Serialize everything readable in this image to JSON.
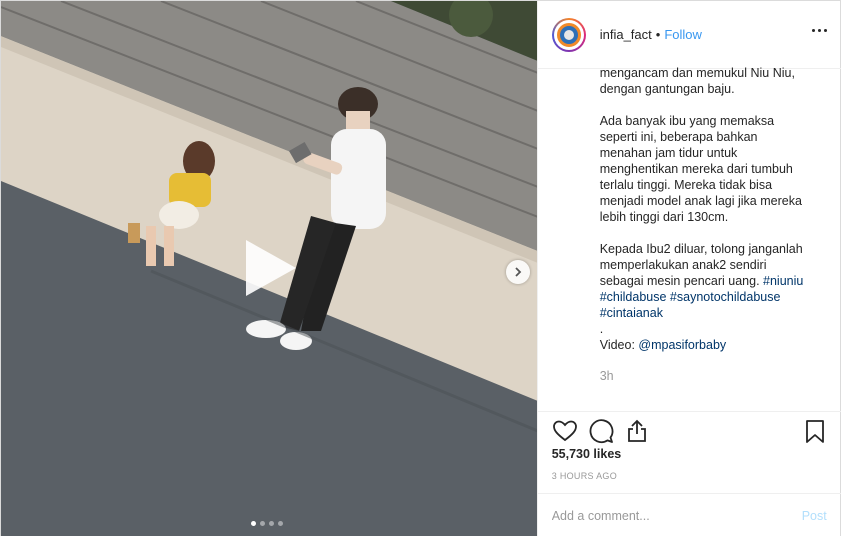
{
  "header": {
    "username": "infia_fact",
    "separator": "•",
    "follow_label": "Follow"
  },
  "caption": {
    "lines_part1": "mengancam dan memukul Niu Niu,\ndengan gantungan baju.",
    "lines_part2": "Ada banyak ibu yang memaksa\nseperti ini, beberapa bahkan\nmenahan jam tidur untuk\nmenghentikan mereka dari tumbuh\nterlalu tinggi. Mereka tidak bisa\nmenjadi model anak lagi jika mereka\nlebih tinggi dari 130cm.",
    "lines_part3_a": "Kepada Ibu2 diluar, tolong janganlah\nmemperlakukan anak2 sendiri\nsebagai mesin pencari uang. ",
    "hashtag_1": "#niuniu",
    "hashtag_2": "#childabuse",
    "hashtag_3": "#saynotochildabuse",
    "hashtag_4": "#cintaianak",
    "dot_line": ".",
    "video_label": "Video: ",
    "video_mention": "@mpasiforbaby"
  },
  "time_short": "3h",
  "likes": "55,730 likes",
  "time_ago": "3 HOURS AGO",
  "comment": {
    "placeholder": "Add a comment...",
    "post_label": "Post"
  },
  "media": {
    "carousel_dots": 4,
    "active_dot": 0
  },
  "icons": {
    "like": "heart-icon",
    "comment": "comment-icon",
    "share": "share-icon",
    "save": "bookmark-icon",
    "more": "more-options-icon",
    "play": "play-icon",
    "next": "chevron-right-icon"
  },
  "colors": {
    "link": "#3897f0",
    "hashtag": "#003569",
    "muted": "#999999",
    "post_disabled": "#b2dffc"
  }
}
